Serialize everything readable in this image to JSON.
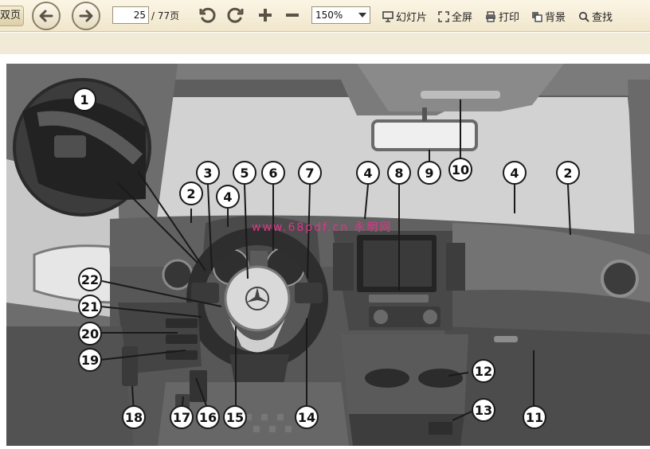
{
  "toolbar": {
    "left_button_label": "双页",
    "page_current": "25",
    "page_total": "/ 77页",
    "zoom_value": "150%",
    "slideshow_label": "幻灯片",
    "fullscreen_label": "全屏",
    "print_label": "打印",
    "background_label": "背景",
    "find_label": "查找"
  },
  "document": {
    "watermark": "www.68pdf.cn 永明网",
    "callouts": [
      "1",
      "2",
      "3",
      "5",
      "6",
      "7",
      "4",
      "8",
      "9",
      "10",
      "4",
      "2",
      "4",
      "22",
      "21",
      "20",
      "19",
      "18",
      "17",
      "16",
      "15",
      "14",
      "13",
      "12",
      "11"
    ]
  }
}
